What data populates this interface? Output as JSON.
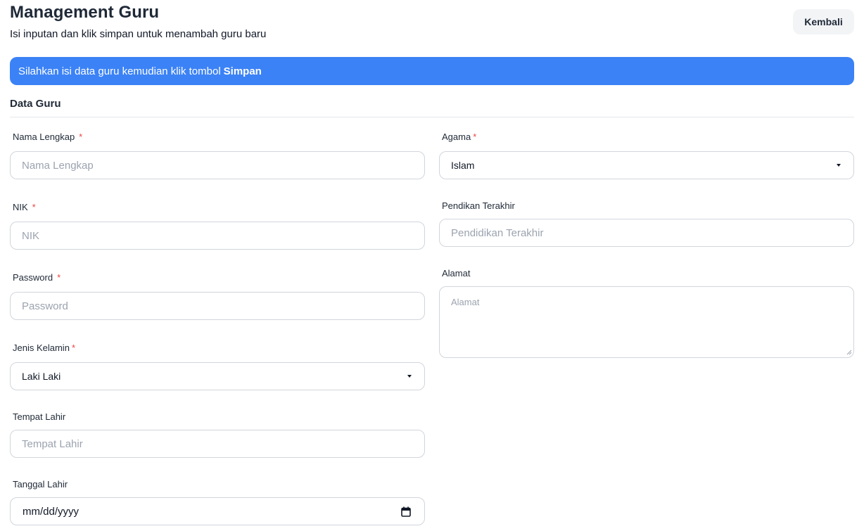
{
  "header": {
    "title": "Management Guru",
    "subtitle": "Isi inputan dan klik simpan untuk menambah guru baru",
    "back_label": "Kembali"
  },
  "alert": {
    "text": "Silahkan isi data guru kemudian klik tombol",
    "emphasis": "Simpan",
    "color": "#3b82f6"
  },
  "section": {
    "title": "Data Guru"
  },
  "required_mark": "*",
  "fields": {
    "nama_lengkap": {
      "label": "Nama Lengkap",
      "placeholder": "Nama Lengkap",
      "value": ""
    },
    "nik": {
      "label": "NIK",
      "placeholder": "NIK",
      "value": ""
    },
    "password": {
      "label": "Password",
      "placeholder": "Password",
      "value": ""
    },
    "jenis_kelamin": {
      "label": "Jenis Kelamin",
      "selected": "Laki Laki"
    },
    "tempat_lahir": {
      "label": "Tempat Lahir",
      "placeholder": "Tempat Lahir",
      "value": ""
    },
    "tanggal_lahir": {
      "label": "Tanggal Lahir",
      "placeholder": "mm/dd/yyyy"
    },
    "agama": {
      "label": "Agama",
      "selected": "Islam"
    },
    "pendidikan_terakhir": {
      "label": "Pendikan Terakhir",
      "placeholder": "Pendidikan Terakhir",
      "value": ""
    },
    "alamat": {
      "label": "Alamat",
      "placeholder": "Alamat",
      "value": ""
    }
  }
}
